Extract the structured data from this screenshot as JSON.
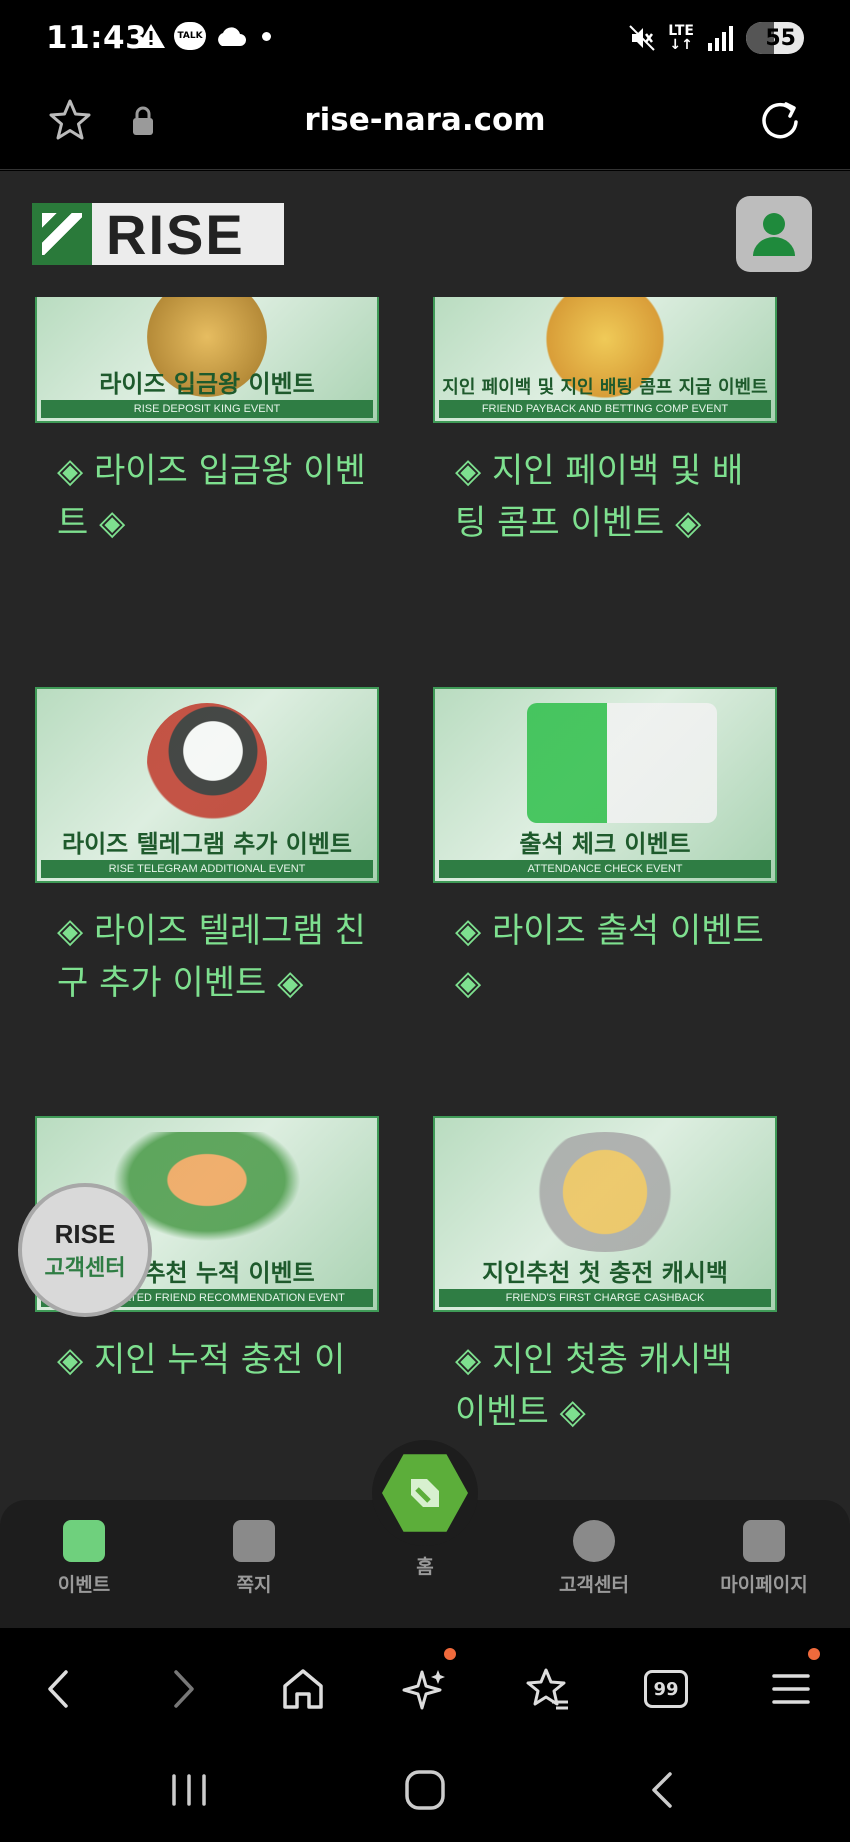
{
  "status_bar": {
    "time": "11:43",
    "talk_label": "TALK",
    "network": "LTE",
    "battery": "55"
  },
  "browser": {
    "url": "rise-nara.com"
  },
  "site": {
    "logo_text": "RISE"
  },
  "cards": [
    {
      "banner_kr": "라이즈 입금왕 이벤트",
      "banner_en": "RISE DEPOSIT KING EVENT",
      "title": "◈ 라이즈 입금왕 이벤트 ◈"
    },
    {
      "banner_kr": "지인 페이백 및 지인 배팅 콤프 지급 이벤트",
      "banner_en": "FRIEND PAYBACK AND BETTING COMP EVENT",
      "title": "◈ 지인 페이백 및 배팅 콤프 이벤트 ◈"
    },
    {
      "banner_kr": "라이즈 텔레그램 추가 이벤트",
      "banner_en": "RISE TELEGRAM ADDITIONAL EVENT",
      "title": "◈ 라이즈 텔레그램 친구 추가 이벤트 ◈"
    },
    {
      "banner_kr": "출석 체크 이벤트",
      "banner_en": "ATTENDANCE CHECK EVENT",
      "title": "◈ 라이즈 출석 이벤트 ◈"
    },
    {
      "banner_kr": "지인추천 누적 이벤트",
      "banner_en": "ACCUMULATED FRIEND RECOMMENDATION EVENT",
      "title": "◈ 지인 누적 충전 이"
    },
    {
      "banner_kr": "지인추천 첫 충전 캐시백",
      "banner_en": "FRIEND'S FIRST CHARGE CASHBACK",
      "title": "◈ 지인 첫충 캐시백 이벤트 ◈"
    }
  ],
  "floating_cs": {
    "line1": "RISE",
    "line2": "고객센터"
  },
  "bottom_nav": {
    "event": "이벤트",
    "message": "쪽지",
    "home": "홈",
    "support": "고객센터",
    "mypage": "마이페이지"
  },
  "browser_toolbar": {
    "tabs_count": "99"
  }
}
